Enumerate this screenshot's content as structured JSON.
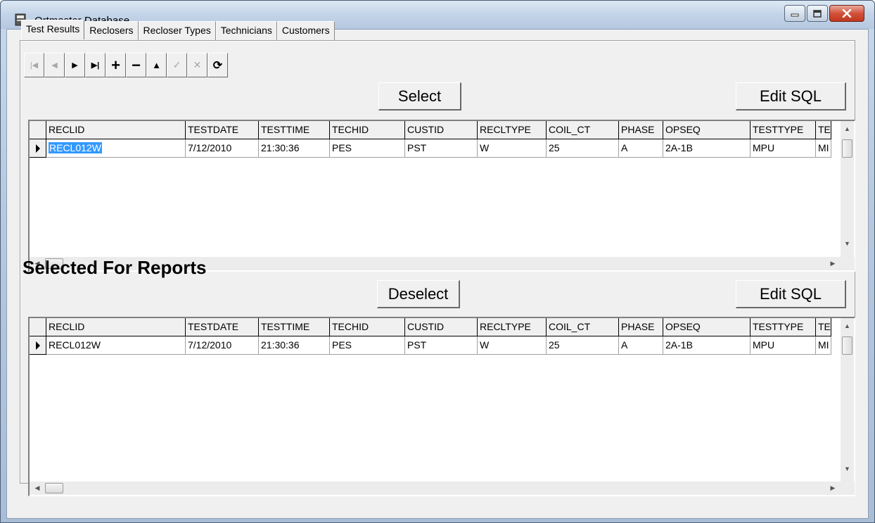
{
  "window": {
    "title": "Ortmaster Database"
  },
  "tabs": [
    {
      "label": "Test Results",
      "active": true
    },
    {
      "label": "Reclosers",
      "active": false
    },
    {
      "label": "Recloser Types",
      "active": false
    },
    {
      "label": "Technicians",
      "active": false
    },
    {
      "label": "Customers",
      "active": false
    }
  ],
  "navigator": {
    "first": "|◀",
    "prior": "◀",
    "next": "▶",
    "last": "▶|",
    "insert": "+",
    "delete": "−",
    "edit": "▲",
    "post": "✓",
    "cancel": "✕",
    "refresh": "⟳"
  },
  "top": {
    "select_label": "Select",
    "edit_sql_label": "Edit SQL"
  },
  "bottom": {
    "heading": "Selected For Reports",
    "deselect_label": "Deselect",
    "edit_sql_label": "Edit SQL"
  },
  "columns": [
    "RECLID",
    "TESTDATE",
    "TESTTIME",
    "TECHID",
    "CUSTID",
    "RECLTYPE",
    "COIL_CT",
    "PHASE",
    "OPSEQ",
    "TESTTYPE",
    "TE"
  ],
  "top_grid": {
    "rows": [
      [
        "RECL012W",
        "7/12/2010",
        "21:30:36",
        "PES",
        "PST",
        "W",
        "25",
        "A",
        "2A-1B",
        "MPU",
        "MI"
      ]
    ]
  },
  "bottom_grid": {
    "rows": [
      [
        "RECL012W",
        "7/12/2010",
        "21:30:36",
        "PES",
        "PST",
        "W",
        "25",
        "A",
        "2A-1B",
        "MPU",
        "MI"
      ]
    ]
  },
  "colors": {
    "selection": "#3399ff",
    "face": "#f0f0f0"
  }
}
